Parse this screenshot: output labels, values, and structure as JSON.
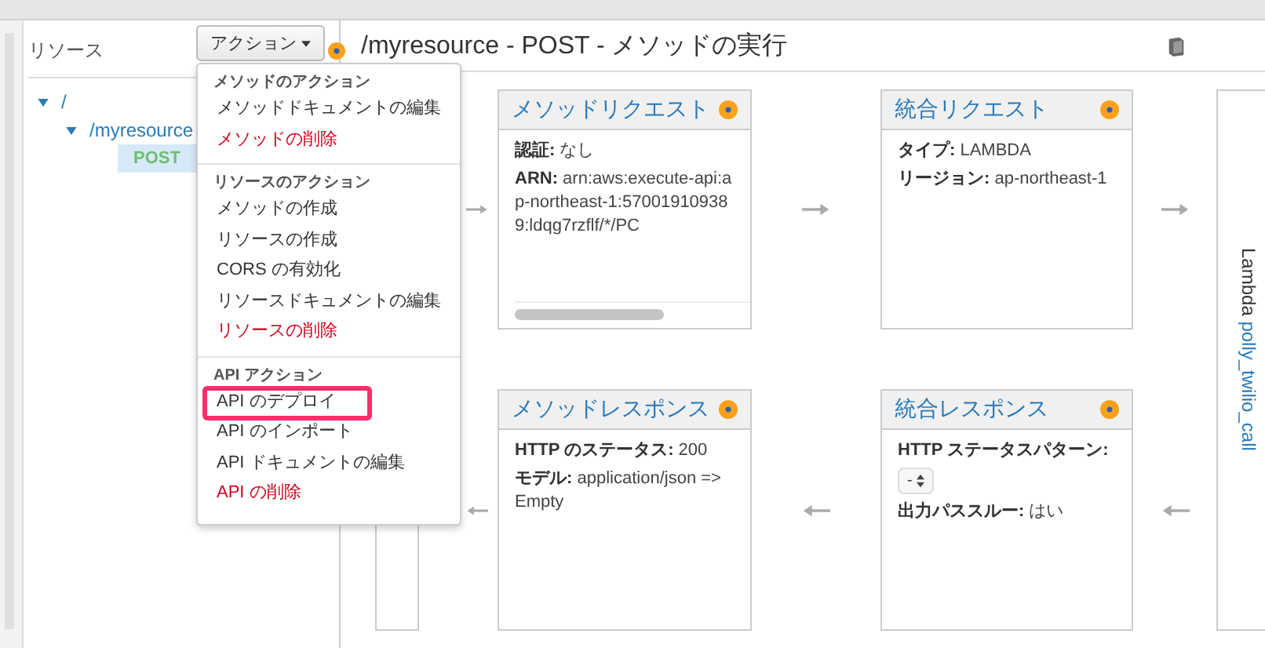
{
  "sidebar": {
    "heading": "リソース",
    "tree": [
      {
        "kind": "resource",
        "label": "/",
        "expanded": true,
        "selected": false,
        "children": [
          {
            "kind": "resource",
            "label": "/myresource",
            "expanded": true,
            "selected": false,
            "children": [
              {
                "kind": "method",
                "label": "POST",
                "selected": true
              }
            ]
          }
        ]
      }
    ]
  },
  "actions_button": {
    "label": "アクション"
  },
  "actions_menu": [
    {
      "header": "メソッドのアクション",
      "items": [
        {
          "label": "メソッドドキュメントの編集",
          "danger": false,
          "highlighted": false
        },
        {
          "label": "メソッドの削除",
          "danger": true,
          "highlighted": false
        }
      ]
    },
    {
      "header": "リソースのアクション",
      "items": [
        {
          "label": "メソッドの作成",
          "danger": false,
          "highlighted": false
        },
        {
          "label": "リソースの作成",
          "danger": false,
          "highlighted": false
        },
        {
          "label": "CORS の有効化",
          "danger": false,
          "highlighted": false
        },
        {
          "label": "リソースドキュメントの編集",
          "danger": false,
          "highlighted": false
        },
        {
          "label": "リソースの削除",
          "danger": true,
          "highlighted": false
        }
      ]
    },
    {
      "header": "API アクション",
      "items": [
        {
          "label": "API のデプロイ",
          "danger": false,
          "highlighted": true
        },
        {
          "label": "API のインポート",
          "danger": false,
          "highlighted": false
        },
        {
          "label": "API ドキュメントの編集",
          "danger": false,
          "highlighted": false
        },
        {
          "label": "API の削除",
          "danger": true,
          "highlighted": false
        }
      ]
    }
  ],
  "page_title": "/myresource - POST - メソッドの実行",
  "cards": [
    {
      "title": "メソッドリクエスト",
      "fields": [
        {
          "kind": "text",
          "label": "認証:",
          "value": "なし"
        },
        {
          "kind": "text",
          "label": "ARN:",
          "value": "arn:aws:execute-api:ap-northeast-1:570019109389:ldqg7rzflf/*/PC"
        }
      ]
    },
    {
      "title": "統合リクエスト",
      "fields": [
        {
          "kind": "text",
          "label": "タイプ:",
          "value": "LAMBDA"
        },
        {
          "kind": "text",
          "label": "リージョン:",
          "value": "ap-northeast-1"
        }
      ]
    },
    {
      "title": "メソッドレスポンス",
      "fields": [
        {
          "kind": "text",
          "label": "HTTP のステータス:",
          "value": "200"
        },
        {
          "kind": "text",
          "label": "モデル:",
          "value": "application/json => Empty"
        }
      ]
    },
    {
      "title": "統合レスポンス",
      "fields": [
        {
          "kind": "label",
          "label": "HTTP ステータスパターン:"
        },
        {
          "kind": "select",
          "value": "-"
        },
        {
          "kind": "text",
          "label": "出力パススルー:",
          "value": "はい"
        }
      ]
    }
  ],
  "backend": {
    "type": "Lambda",
    "name": "polly_twilio_call"
  }
}
